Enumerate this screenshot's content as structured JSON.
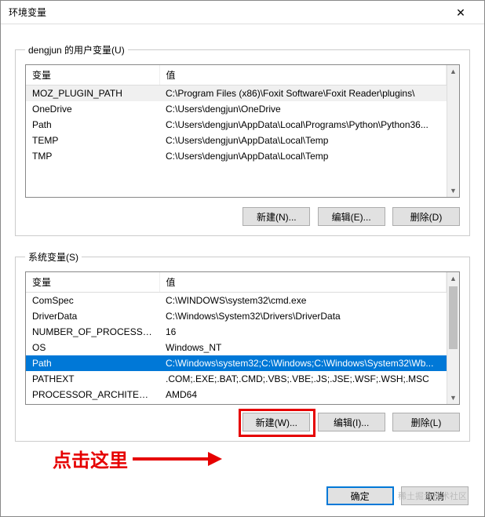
{
  "window": {
    "title": "环境变量",
    "close": "✕"
  },
  "user_section": {
    "legend": "dengjun 的用户变量(U)",
    "col_var": "变量",
    "col_val": "值",
    "rows": [
      {
        "var": "MOZ_PLUGIN_PATH",
        "val": "C:\\Program Files (x86)\\Foxit Software\\Foxit Reader\\plugins\\",
        "sel": true
      },
      {
        "var": "OneDrive",
        "val": "C:\\Users\\dengjun\\OneDrive"
      },
      {
        "var": "Path",
        "val": "C:\\Users\\dengjun\\AppData\\Local\\Programs\\Python\\Python36..."
      },
      {
        "var": "TEMP",
        "val": "C:\\Users\\dengjun\\AppData\\Local\\Temp"
      },
      {
        "var": "TMP",
        "val": "C:\\Users\\dengjun\\AppData\\Local\\Temp"
      }
    ],
    "btn_new": "新建(N)...",
    "btn_edit": "编辑(E)...",
    "btn_del": "删除(D)"
  },
  "sys_section": {
    "legend": "系统变量(S)",
    "col_var": "变量",
    "col_val": "值",
    "rows": [
      {
        "var": "ComSpec",
        "val": "C:\\WINDOWS\\system32\\cmd.exe"
      },
      {
        "var": "DriverData",
        "val": "C:\\Windows\\System32\\Drivers\\DriverData"
      },
      {
        "var": "NUMBER_OF_PROCESSORS",
        "val": "16"
      },
      {
        "var": "OS",
        "val": "Windows_NT"
      },
      {
        "var": "Path",
        "val": "C:\\Windows\\system32;C:\\Windows;C:\\Windows\\System32\\Wb...",
        "sel": true
      },
      {
        "var": "PATHEXT",
        "val": ".COM;.EXE;.BAT;.CMD;.VBS;.VBE;.JS;.JSE;.WSF;.WSH;.MSC"
      },
      {
        "var": "PROCESSOR_ARCHITECT...",
        "val": "AMD64"
      }
    ],
    "btn_new": "新建(W)...",
    "btn_edit": "编辑(I)...",
    "btn_del": "删除(L)"
  },
  "footer": {
    "ok": "确定",
    "cancel": "取消"
  },
  "annotation": {
    "text": "点击这里"
  },
  "watermark": "稀土掘金技术社区"
}
